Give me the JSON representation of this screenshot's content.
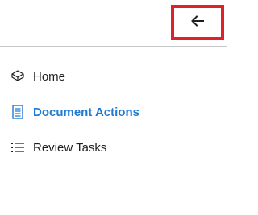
{
  "header": {
    "back_icon": "arrow-left-icon"
  },
  "nav": {
    "items": [
      {
        "label": "Home",
        "icon": "home-box-icon",
        "active": false
      },
      {
        "label": "Document Actions",
        "icon": "document-icon",
        "active": true
      },
      {
        "label": "Review Tasks",
        "icon": "bulleted-list-icon",
        "active": false
      }
    ]
  },
  "colors": {
    "accent": "#1f7ad4",
    "highlight_box": "#e0202b",
    "text": "#201f1e",
    "divider": "#c8c8c8"
  }
}
